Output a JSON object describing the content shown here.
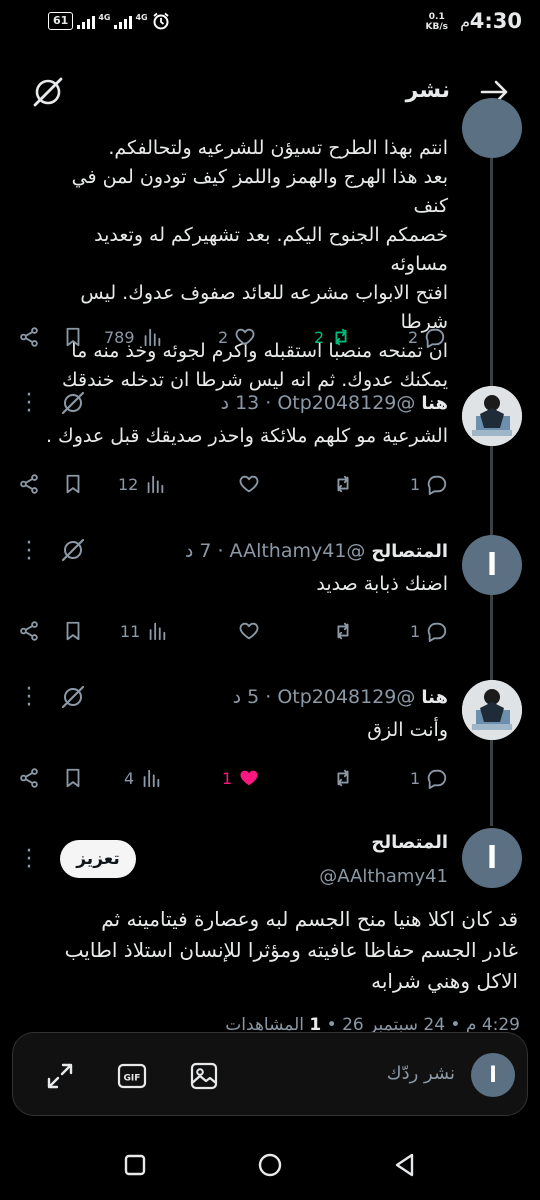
{
  "status_bar": {
    "time": "4:30",
    "ampm": "م",
    "net_speed_value": "0.1",
    "net_speed_unit": "KB/s",
    "battery": "61",
    "network_tag_1": "4G",
    "network_tag_2": "4G"
  },
  "header": {
    "title": "نشر"
  },
  "top_post": {
    "lines": [
      "انتم بهذا الطرح تسيؤن للشرعيه ولتحالفكم.",
      "بعد هذا الهرج والهمز واللمز كيف تودون لمن في كنف",
      "خصمكم الجنوح اليكم. بعد تشهيركم له وتعديد مساوئه",
      "افتح الابواب مشرعه للعائد صفوف عدوك. ليس شرطا",
      "ان تمنحه منصبا استقبله واكرم لجوئه وخذ منه ما",
      "يمكنك عدوك. ثم انه ليس شرطا ان تدخله خندقك"
    ],
    "replies": "2",
    "reposts": "2",
    "likes": "2",
    "views": "789"
  },
  "replies": [
    {
      "avatar": "photo",
      "name": "هنا",
      "handle": "@Otp2048129",
      "time": "13 د",
      "text": "الشرعية مو كلهم ملائكة واحذر صديقك قبل عدوك .",
      "replies": "1",
      "reposts": "",
      "likes": "",
      "views": "12"
    },
    {
      "avatar": "letter",
      "avatar_letter": "ا",
      "name": "المتصالح",
      "handle": "@AAlthamy41",
      "time": "7 د",
      "text": "اضنك ذبابة صديد",
      "replies": "1",
      "reposts": "",
      "likes": "",
      "views": "11"
    },
    {
      "avatar": "photo",
      "name": "هنا",
      "handle": "@Otp2048129",
      "time": "5 د",
      "text": "وأنت الزق",
      "replies": "1",
      "reposts": "",
      "likes": "1",
      "views": "4"
    }
  ],
  "focused_post": {
    "avatar_letter": "ا",
    "name": "المتصالح",
    "handle": "@AAlthamy41",
    "boost_label": "تعزيز",
    "lines": [
      "قد كان اكلا هنيا منح الجسم لبه وعصارة فيتامينه ثم",
      "غادر الجسم حفاظا عافيته ومؤثرا للإنسان استلاذ اطايب",
      "الاكل وهني شرابه"
    ],
    "footer_time": "4:29 م",
    "footer_date": "24 سبتمبر 26",
    "footer_views_count": "1",
    "footer_views_label": "المشاهدات"
  },
  "composer": {
    "placeholder": "نشر ردّك",
    "me_letter": "ا",
    "gif_label": "GIF"
  },
  "colors": {
    "background": "#000000",
    "muted": "#8b98a5",
    "repost_active": "#00ba7c",
    "like_active": "#f91880",
    "avatar_letter_bg": "#5b7083"
  }
}
